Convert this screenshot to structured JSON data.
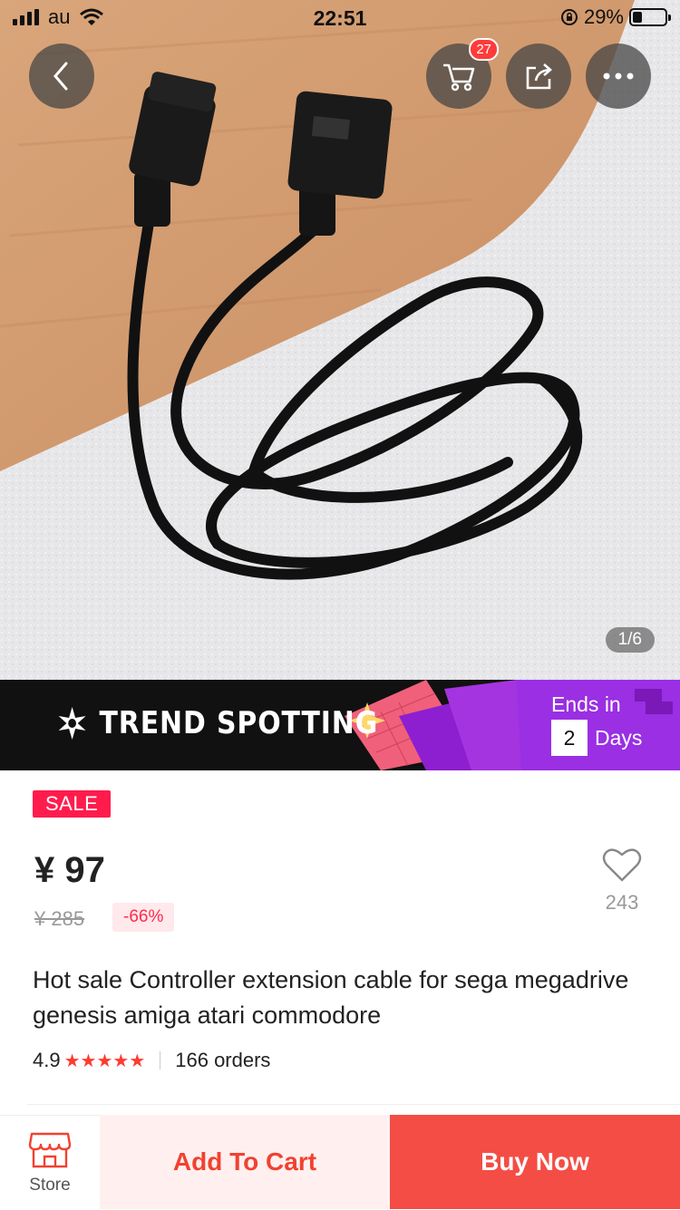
{
  "status_bar": {
    "carrier": "au",
    "time": "22:51",
    "battery_text": "29%",
    "battery_level": 0.29
  },
  "top_nav": {
    "cart_badge": "27",
    "icons": [
      "back-icon",
      "cart-icon",
      "share-icon",
      "more-icon"
    ]
  },
  "gallery": {
    "counter": "1/6"
  },
  "banner": {
    "title": "TREND SPOTTING",
    "ends_in": "Ends in",
    "days_number": "2",
    "days_label": "Days"
  },
  "product": {
    "sale_tag": "SALE",
    "price": "¥ 97",
    "original_price": "¥ 285",
    "discount": "-66%",
    "wishlist_count": "243",
    "title": "Hot sale Controller extension cable for sega megadrive genesis amiga atari commodore",
    "rating": "4.9",
    "orders": "166 orders"
  },
  "bottom_bar": {
    "store_label": "Store",
    "add_to_cart": "Add To Cart",
    "buy_now": "Buy Now"
  },
  "colors": {
    "accent_red": "#f44d45",
    "sale_pink": "#ff1c4d",
    "star_red": "#ff3b2f"
  }
}
